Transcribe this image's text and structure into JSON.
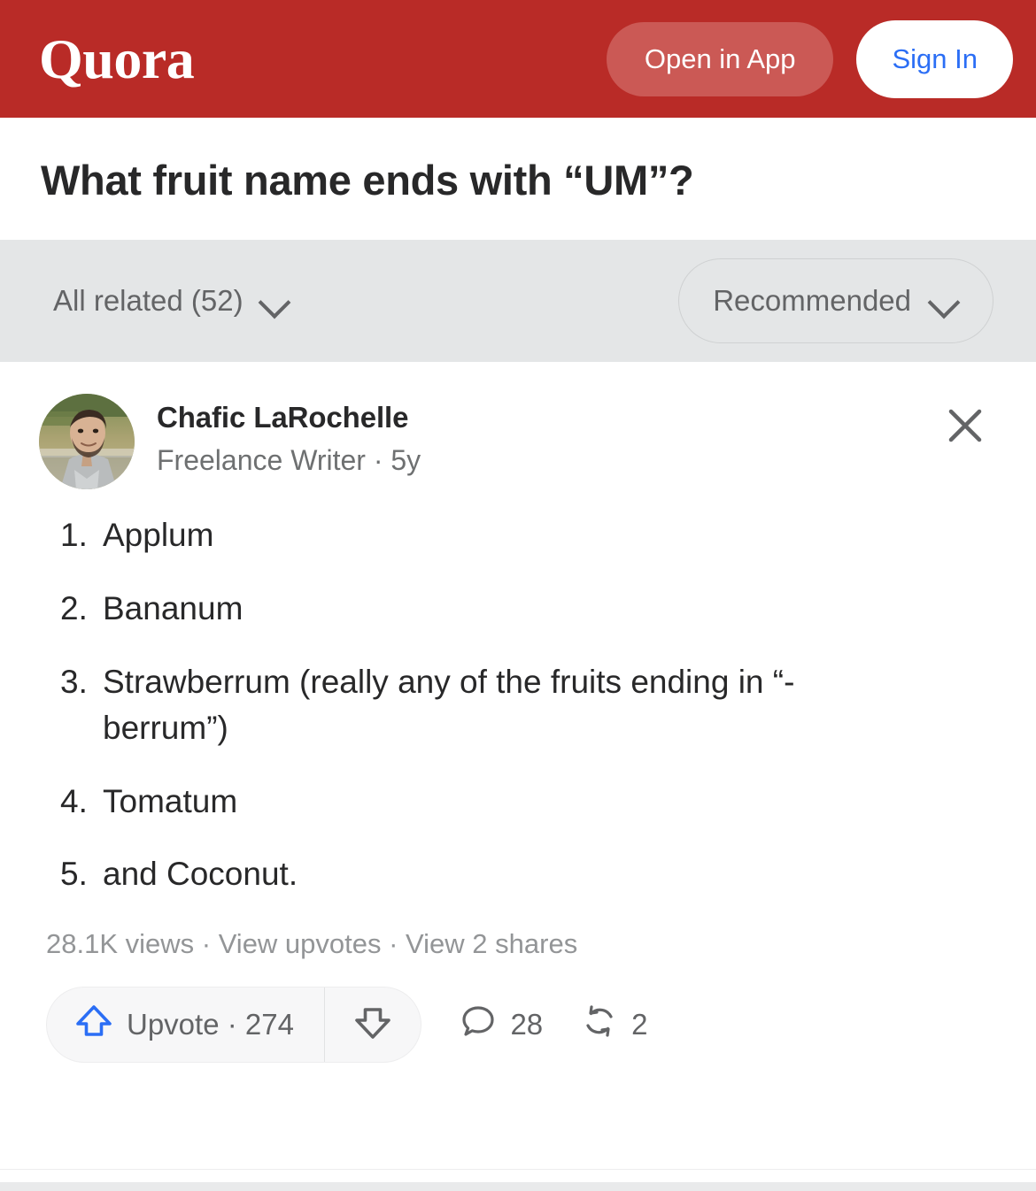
{
  "header": {
    "logo": "Quora",
    "open_in_app_label": "Open in App",
    "sign_in_label": "Sign In",
    "brand_red": "#b92b27",
    "open_in_app_bg": "#cb5955",
    "sign_in_color": "#2b6ef5"
  },
  "question": {
    "title": "What fruit name ends with “UM”?"
  },
  "filter_bar": {
    "related_label": "All related (52)",
    "sort_label": "Recommended",
    "background": "#e4e6e7",
    "text_color": "#636466"
  },
  "answer": {
    "author": {
      "name": "Chafic LaRochelle",
      "credential": "Freelance Writer · 5y"
    },
    "close_label": "×",
    "list": [
      {
        "num": "1.",
        "text": "Applum"
      },
      {
        "num": "2.",
        "text": "Bananum"
      },
      {
        "num": "3.",
        "text": "Strawberrum (really any of the fruits ending in “-berrum”)"
      },
      {
        "num": "4.",
        "text": "Tomatum"
      },
      {
        "num": "5.",
        "text": "and Coconut."
      }
    ],
    "stats": "28.1K views · View upvotes · View 2 shares",
    "actions": {
      "upvote_label": "Upvote · 274",
      "upvote_color": "#2b6ef5",
      "comment_count": "28",
      "share_count": "2"
    }
  }
}
